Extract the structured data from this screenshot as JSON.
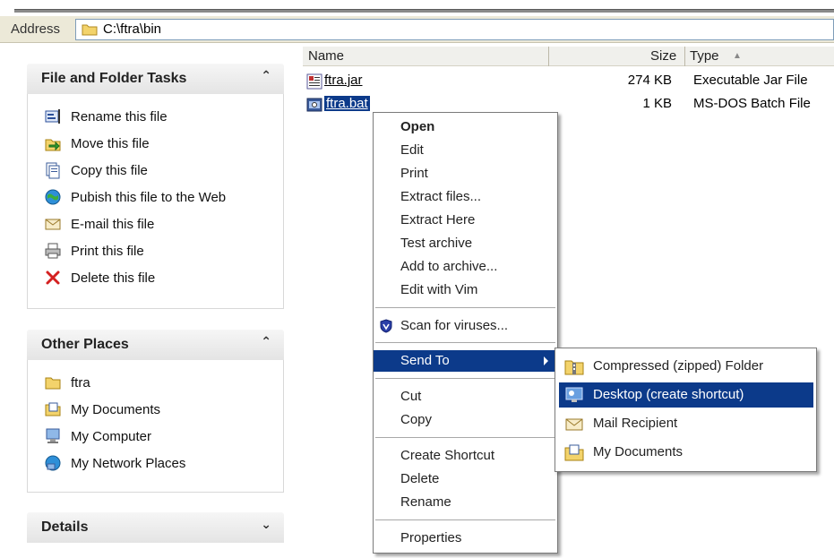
{
  "address": {
    "label": "Address",
    "path": "C:\\ftra\\bin"
  },
  "panels": {
    "file_tasks": {
      "title": "File and Folder Tasks",
      "toggle": "⌃",
      "items": [
        {
          "label": "Rename this file",
          "icon": "rename-icon"
        },
        {
          "label": "Move this file",
          "icon": "move-icon"
        },
        {
          "label": "Copy this file",
          "icon": "copy-icon"
        },
        {
          "label": "Pubish this file to the Web",
          "icon": "publish-web-icon"
        },
        {
          "label": "E-mail this file",
          "icon": "email-icon"
        },
        {
          "label": "Print this file",
          "icon": "print-icon"
        },
        {
          "label": "Delete this file",
          "icon": "delete-icon"
        }
      ]
    },
    "other_places": {
      "title": "Other Places",
      "toggle": "⌃",
      "items": [
        {
          "label": "ftra",
          "icon": "folder-icon"
        },
        {
          "label": "My Documents",
          "icon": "my-documents-icon"
        },
        {
          "label": "My Computer",
          "icon": "my-computer-icon"
        },
        {
          "label": "My Network Places",
          "icon": "network-places-icon"
        }
      ]
    },
    "details": {
      "title": "Details",
      "toggle": "⌄"
    }
  },
  "columns": {
    "name": "Name",
    "size": "Size",
    "type": "Type",
    "sort_indicator": "▲"
  },
  "files": [
    {
      "name": "ftra.jar",
      "size": "274 KB",
      "type": "Executable Jar File",
      "icon": "jar-file-icon"
    },
    {
      "name": "ftra.bat",
      "size": "1 KB",
      "type": "MS-DOS Batch File",
      "icon": "batch-file-icon"
    }
  ],
  "context_menu": {
    "items": [
      {
        "label": "Open",
        "bold": true
      },
      {
        "label": "Edit"
      },
      {
        "label": "Print"
      },
      {
        "label": "Extract files..."
      },
      {
        "label": "Extract Here"
      },
      {
        "label": "Test archive"
      },
      {
        "label": "Add to archive..."
      },
      {
        "label": "Edit with Vim"
      },
      {
        "label": "Scan for viruses...",
        "icon": "antivirus-shield-icon"
      },
      {
        "label": "Send To",
        "highlighted": true,
        "submenu": true
      },
      {
        "label": "Cut"
      },
      {
        "label": "Copy"
      },
      {
        "label": "Create Shortcut"
      },
      {
        "label": "Delete"
      },
      {
        "label": "Rename"
      },
      {
        "label": "Properties"
      }
    ]
  },
  "send_to_menu": {
    "items": [
      {
        "label": "Compressed (zipped) Folder",
        "icon": "zip-folder-icon"
      },
      {
        "label": "Desktop (create shortcut)",
        "icon": "desktop-icon",
        "highlighted": true
      },
      {
        "label": "Mail Recipient",
        "icon": "mail-recipient-icon"
      },
      {
        "label": "My Documents",
        "icon": "my-documents-icon"
      }
    ]
  },
  "colors": {
    "highlight": "#0c3a8a",
    "pane_header": "#e4e4e4",
    "menu_bg": "#ffffff"
  }
}
